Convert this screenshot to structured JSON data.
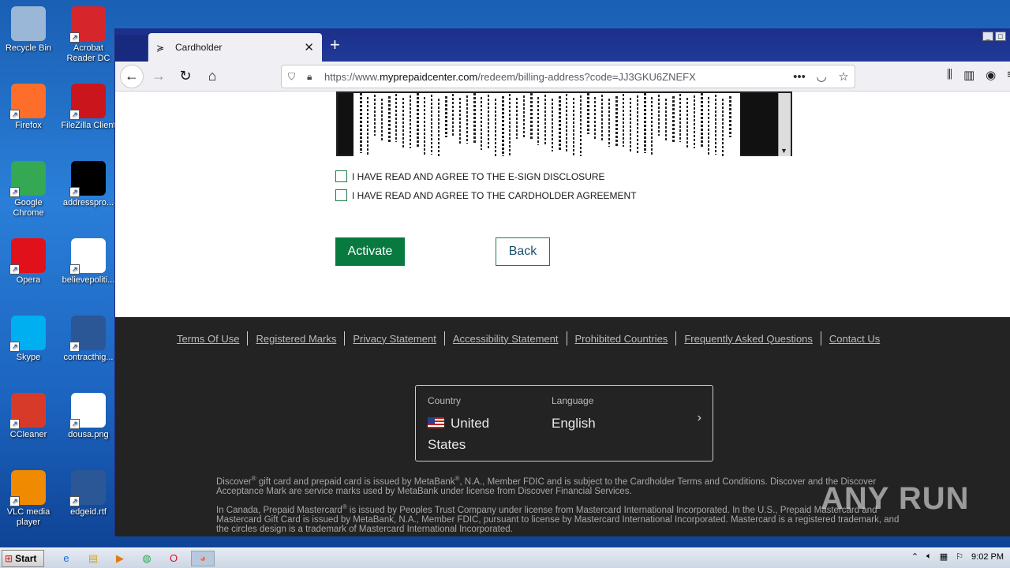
{
  "desktop": {
    "icons": [
      {
        "label": "Recycle Bin",
        "icon": "recycle-bin-icon",
        "color": "#9ab7d8"
      },
      {
        "label": "Acrobat Reader DC",
        "icon": "acrobat-icon",
        "color": "#d6262b"
      },
      {
        "label": "Firefox",
        "icon": "firefox-icon",
        "color": "#ff6d2a"
      },
      {
        "label": "FileZilla Client",
        "icon": "filezilla-icon",
        "color": "#c9151b"
      },
      {
        "label": "Google Chrome",
        "icon": "chrome-icon",
        "color": "#34a853"
      },
      {
        "label": "addresspro...",
        "icon": "file-icon",
        "color": "#000000"
      },
      {
        "label": "Opera",
        "icon": "opera-icon",
        "color": "#e0111b"
      },
      {
        "label": "believepoliti...",
        "icon": "file-icon",
        "color": "#ffffff"
      },
      {
        "label": "Skype",
        "icon": "skype-icon",
        "color": "#00aff0"
      },
      {
        "label": "contracthig...",
        "icon": "word-icon",
        "color": "#2b5797"
      },
      {
        "label": "CCleaner",
        "icon": "ccleaner-icon",
        "color": "#d83a2a"
      },
      {
        "label": "dousa.png",
        "icon": "file-icon",
        "color": "#ffffff"
      },
      {
        "label": "VLC media player",
        "icon": "vlc-icon",
        "color": "#f08a00"
      },
      {
        "label": "edgeid.rtf",
        "icon": "word-icon",
        "color": "#2b5797"
      }
    ]
  },
  "browser": {
    "tab_title": "Cardholder",
    "tab_close": "✕",
    "new_tab": "+",
    "url_prefix": "https://www.",
    "url_domain": "myprepaidcenter.com",
    "url_path": "/redeem/billing-address?code=JJ3GKU6ZNEFX",
    "more_icon": "•••"
  },
  "page": {
    "checkbox_esign": "I HAVE READ AND AGREE TO THE E-SIGN DISCLOSURE",
    "checkbox_cardholder": "I HAVE READ AND AGREE TO THE CARDHOLDER AGREEMENT",
    "activate_label": "Activate",
    "back_label": "Back",
    "accent": "#08793f"
  },
  "footer": {
    "links": [
      "Terms Of Use",
      "Registered Marks",
      "Privacy Statement",
      "Accessibility Statement",
      "Prohibited Countries",
      "Frequently Asked Questions",
      "Contact Us"
    ],
    "country_label": "Country",
    "country_value_1": "United",
    "country_value_2": "States",
    "language_label": "Language",
    "language_value": "English",
    "legal_1a": "Discover",
    "legal_1b": " gift card and prepaid card is issued by MetaBank",
    "legal_1c": ", N.A., Member FDIC and is subject to the Cardholder Terms and Conditions. Discover and the Discover Acceptance Mark are service marks used by MetaBank under license from Discover Financial Services.",
    "legal_2a": "In Canada, Prepaid Mastercard",
    "legal_2b": " is issued by Peoples Trust Company under license from Mastercard International Incorporated. In the U.S., Prepaid Mastercard and Mastercard Gift Card is issued by MetaBank, N.A., Member FDIC, pursuant to license by Mastercard International Incorporated. Mastercard is a registered trademark, and the circles design is a trademark of Mastercard International Incorporated.",
    "reg": "®"
  },
  "watermark": "ANY RUN",
  "taskbar": {
    "start_label": "Start",
    "clock": "9:02 PM"
  }
}
